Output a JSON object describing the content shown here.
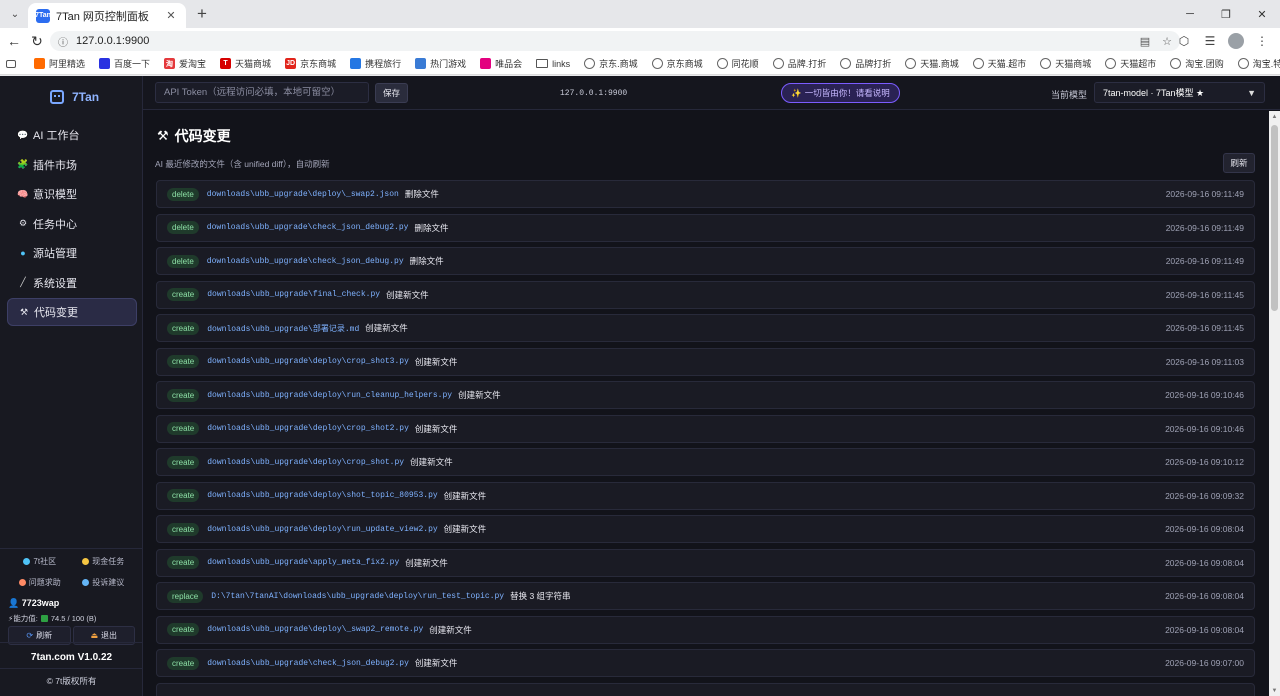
{
  "browser": {
    "tab_title": "7Tan 网页控制面板",
    "tab_favicon_text": "7Tan",
    "new_tab_label": "+",
    "url": "127.0.0.1:9900",
    "bookmarks": [
      {
        "label": "阿里精选",
        "icon": "ali-icon",
        "color": "#ff6a00"
      },
      {
        "label": "百度一下",
        "icon": "baidu-icon",
        "color": "#2932e1"
      },
      {
        "label": "爱淘宝",
        "icon": "aitaobao-icon",
        "color": "#e4393c",
        "glyph": "淘"
      },
      {
        "label": "天猫商城",
        "icon": "tmall-icon",
        "color": "#d60000",
        "glyph": "T"
      },
      {
        "label": "京东商城",
        "icon": "jd-icon",
        "color": "#e1251b",
        "glyph": "JD"
      },
      {
        "label": "携程旅行",
        "icon": "ctrip-icon",
        "color": "#2577e3"
      },
      {
        "label": "热门游戏",
        "icon": "game-icon",
        "color": "#3a7bd5"
      },
      {
        "label": "唯品会",
        "icon": "vip-icon",
        "color": "#e3007f"
      },
      {
        "label": "links",
        "icon": "folder-icon",
        "color": ""
      },
      {
        "label": "京东.商城",
        "icon": "globe-icon",
        "color": ""
      },
      {
        "label": "京东商城",
        "icon": "globe-icon",
        "color": ""
      },
      {
        "label": "同花顺",
        "icon": "globe-icon",
        "color": ""
      },
      {
        "label": "品牌.打折",
        "icon": "globe-icon",
        "color": ""
      },
      {
        "label": "品牌打折",
        "icon": "globe-icon",
        "color": ""
      },
      {
        "label": "天猫.商城",
        "icon": "globe-icon",
        "color": ""
      },
      {
        "label": "天猫.超市",
        "icon": "globe-icon",
        "color": ""
      },
      {
        "label": "天猫商城",
        "icon": "globe-icon",
        "color": ""
      },
      {
        "label": "天猫超市",
        "icon": "globe-icon",
        "color": ""
      },
      {
        "label": "淘宝.团购",
        "icon": "globe-icon",
        "color": ""
      },
      {
        "label": "淘宝.特惠",
        "icon": "globe-icon",
        "color": ""
      }
    ]
  },
  "sidebar": {
    "logo_text": "7Tan",
    "items": [
      {
        "label": "AI 工作台",
        "icon": "chat-icon",
        "glyph": "💬",
        "active": false
      },
      {
        "label": "插件市场",
        "icon": "puzzle-icon",
        "glyph": "🧩",
        "active": false
      },
      {
        "label": "意识模型",
        "icon": "brain-icon",
        "glyph": "🧠",
        "active": false
      },
      {
        "label": "任务中心",
        "icon": "gear-icon",
        "glyph": "⚙",
        "active": false
      },
      {
        "label": "源站管理",
        "icon": "globe-icon",
        "glyph": "●",
        "active": false
      },
      {
        "label": "系统设置",
        "icon": "wrench-icon",
        "glyph": "╱",
        "active": false
      },
      {
        "label": "代码变更",
        "icon": "tools-icon",
        "glyph": "⚒",
        "active": true
      }
    ],
    "links": [
      {
        "label": "7t社区",
        "color": "#4fc3f7"
      },
      {
        "label": "现金任务",
        "color": "#f5c542"
      },
      {
        "label": "问题求助",
        "color": "#ff8a65"
      },
      {
        "label": "投诉建议",
        "color": "#64b5f6"
      }
    ],
    "user": {
      "name": "7723wap",
      "power_label": "能力值:",
      "power_value": "74.5 / 100 (B)"
    },
    "refresh_label": "刷新",
    "logout_label": "退出",
    "version": "7tan.com V1.0.22",
    "copyright": "© 7t版权所有"
  },
  "header": {
    "token_placeholder": "API Token（远程访问必填，本地可留空）",
    "save_label": "保存",
    "host": "127.0.0.1:9900",
    "notice_star": "✨",
    "notice_label": "一切皆由你！请看说明",
    "model_label": "当前模型",
    "model_value": "7tan-model · 7Tan模型 ★"
  },
  "main": {
    "title": "代码变更",
    "title_icon": "⚒",
    "subtitle": "AI 最近修改的文件（含 unified diff），自动刷新",
    "refresh_label": "刷新",
    "changes": [
      {
        "action": "delete",
        "path": "downloads\\ubb_upgrade\\deploy\\_swap2.json",
        "desc": "删除文件",
        "time": "2026-09-16 09:11:49"
      },
      {
        "action": "delete",
        "path": "downloads\\ubb_upgrade\\check_json_debug2.py",
        "desc": "删除文件",
        "time": "2026-09-16 09:11:49"
      },
      {
        "action": "delete",
        "path": "downloads\\ubb_upgrade\\check_json_debug.py",
        "desc": "删除文件",
        "time": "2026-09-16 09:11:49"
      },
      {
        "action": "create",
        "path": "downloads\\ubb_upgrade\\final_check.py",
        "desc": "创建新文件",
        "time": "2026-09-16 09:11:45"
      },
      {
        "action": "create",
        "path": "downloads\\ubb_upgrade\\部署记录.md",
        "desc": "创建新文件",
        "time": "2026-09-16 09:11:45"
      },
      {
        "action": "create",
        "path": "downloads\\ubb_upgrade\\deploy\\crop_shot3.py",
        "desc": "创建新文件",
        "time": "2026-09-16 09:11:03"
      },
      {
        "action": "create",
        "path": "downloads\\ubb_upgrade\\deploy\\run_cleanup_helpers.py",
        "desc": "创建新文件",
        "time": "2026-09-16 09:10:46"
      },
      {
        "action": "create",
        "path": "downloads\\ubb_upgrade\\deploy\\crop_shot2.py",
        "desc": "创建新文件",
        "time": "2026-09-16 09:10:46"
      },
      {
        "action": "create",
        "path": "downloads\\ubb_upgrade\\deploy\\crop_shot.py",
        "desc": "创建新文件",
        "time": "2026-09-16 09:10:12"
      },
      {
        "action": "create",
        "path": "downloads\\ubb_upgrade\\deploy\\shot_topic_80953.py",
        "desc": "创建新文件",
        "time": "2026-09-16 09:09:32"
      },
      {
        "action": "create",
        "path": "downloads\\ubb_upgrade\\deploy\\run_update_view2.py",
        "desc": "创建新文件",
        "time": "2026-09-16 09:08:04"
      },
      {
        "action": "create",
        "path": "downloads\\ubb_upgrade\\apply_meta_fix2.py",
        "desc": "创建新文件",
        "time": "2026-09-16 09:08:04"
      },
      {
        "action": "replace",
        "path": "D:\\7tan\\7tanAI\\downloads\\ubb_upgrade\\deploy\\run_test_topic.py",
        "desc": "替换 3 组字符串",
        "time": "2026-09-16 09:08:04"
      },
      {
        "action": "create",
        "path": "downloads\\ubb_upgrade\\deploy\\_swap2_remote.py",
        "desc": "创建新文件",
        "time": "2026-09-16 09:08:04"
      },
      {
        "action": "create",
        "path": "downloads\\ubb_upgrade\\check_json_debug2.py",
        "desc": "创建新文件",
        "time": "2026-09-16 09:07:00"
      },
      {
        "action": "create",
        "path": "",
        "desc": "",
        "time": ""
      }
    ]
  }
}
